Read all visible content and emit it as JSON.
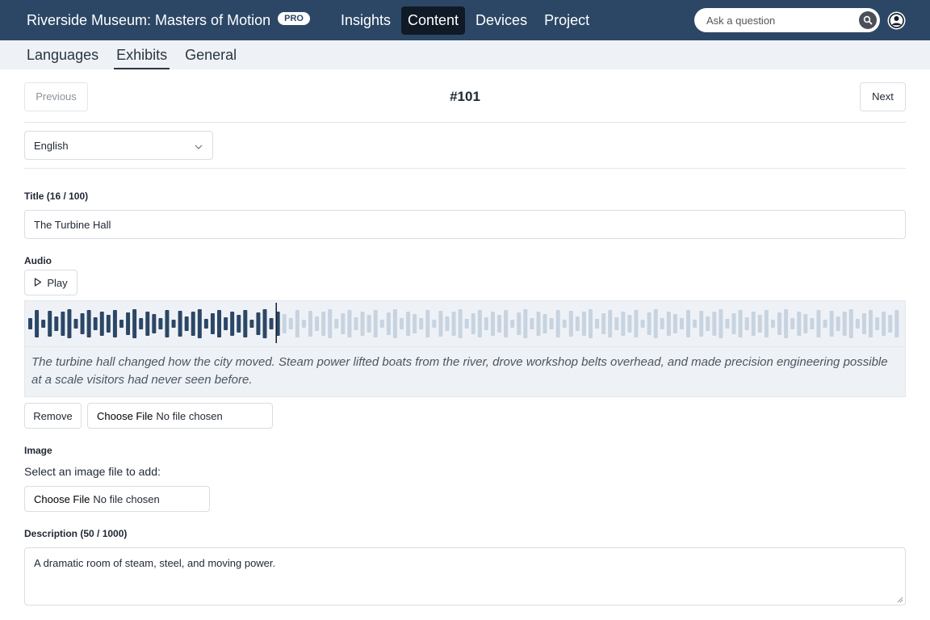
{
  "header": {
    "app_title": "Riverside Museum: Masters of Motion",
    "badge": "PRO",
    "nav": [
      {
        "label": "Insights"
      },
      {
        "label": "Content",
        "active": true
      },
      {
        "label": "Devices"
      },
      {
        "label": "Project"
      }
    ],
    "search_placeholder": "Ask a question",
    "search_icon": "search-icon",
    "user_icon": "user-circle-icon"
  },
  "subnav": {
    "tabs": [
      {
        "label": "Languages"
      },
      {
        "label": "Exhibits",
        "active": true
      },
      {
        "label": "General"
      }
    ]
  },
  "pager": {
    "previous_label": "Previous",
    "next_label": "Next",
    "record_id": "#101"
  },
  "language": {
    "selected": "English",
    "icon": "chevron-down-icon"
  },
  "title_field": {
    "label": "Title (16 / 100)",
    "value": "The Turbine Hall"
  },
  "audio": {
    "label": "Audio",
    "play_label": "Play",
    "play_icon": "play-icon",
    "progress": 0.285,
    "transcript": "The turbine hall changed how the city moved. Steam power lifted boats from the river, drove workshop belts overhead, and made precision engineering possible at a scale visitors had never seen before.",
    "remove_label": "Remove",
    "file_choose_label": "Choose File",
    "file_status": "No file chosen",
    "played_color": "#2c4766",
    "unplayed_color": "#c8d3e0"
  },
  "image": {
    "label": "Image",
    "prompt": "Select an image file to add:",
    "file_choose_label": "Choose File",
    "file_status": "No file chosen"
  },
  "description": {
    "label": "Description (50 / 1000)",
    "value": "A dramatic room of steam, steel, and moving power."
  },
  "colors": {
    "header_bg": "#2c4766",
    "nav_active_bg": "#101a26",
    "subnav_bg": "#eef2f7"
  }
}
